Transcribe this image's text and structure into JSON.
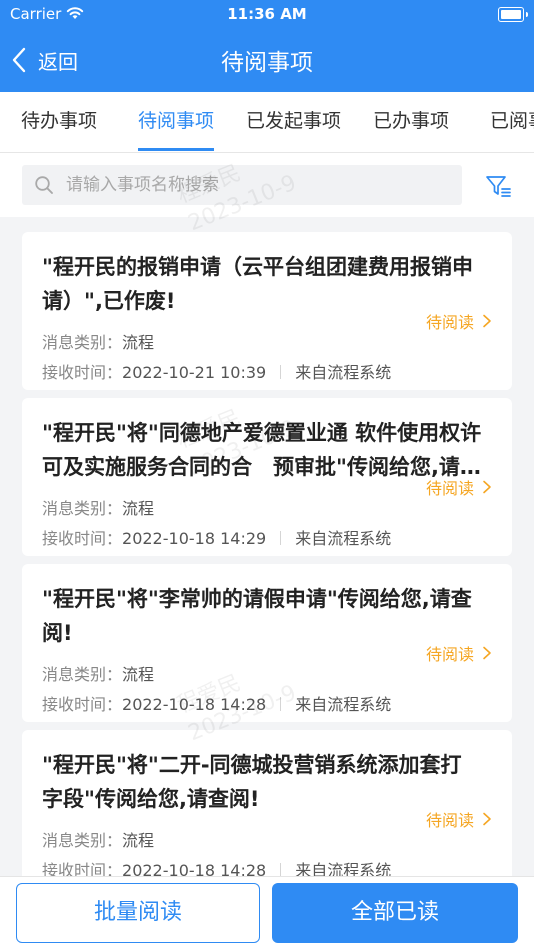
{
  "status_bar": {
    "carrier": "Carrier",
    "time": "11:36 AM"
  },
  "nav": {
    "back_label": "返回",
    "title": "待阅事项"
  },
  "tabs": [
    {
      "label": "待办事项"
    },
    {
      "label": "待阅事项"
    },
    {
      "label": "已发起事项"
    },
    {
      "label": "已办事项"
    },
    {
      "label": "已阅事项"
    }
  ],
  "search": {
    "placeholder": "请输入事项名称搜索"
  },
  "watermark": {
    "name": "程爱民",
    "date": "2023-10-9"
  },
  "labels": {
    "type_label": "消息类别：",
    "time_label": "接收时间："
  },
  "items": [
    {
      "title": "\"程开民的报销申请（云平台组团建费用报销申请）\",已作废!",
      "status": "待阅读",
      "type": "流程",
      "time": "2022-10-21 10:39",
      "source": "来自流程系统"
    },
    {
      "title": "\"程开民\"将\"同德地产爱德置业通 软件使用权许可及实施服务合同的合　预审批\"传阅给您,请查阅!",
      "status": "待阅读",
      "type": "流程",
      "time": "2022-10-18 14:29",
      "source": "来自流程系统"
    },
    {
      "title": "\"程开民\"将\"李常帅的请假申请\"传阅给您,请查阅!",
      "status": "待阅读",
      "type": "流程",
      "time": "2022-10-18 14:28",
      "source": "来自流程系统"
    },
    {
      "title": "\"程开民\"将\"二开-同德城投营销系统添加套打字段\"传阅给您,请查阅!",
      "status": "待阅读",
      "type": "流程",
      "time": "2022-10-18 14:28",
      "source": "来自流程系统"
    }
  ],
  "bottom": {
    "batch_label": "批量阅读",
    "all_read_label": "全部已读"
  },
  "colors": {
    "primary": "#2f8bf3",
    "status": "#f5a623",
    "background": "#f3f4f6"
  }
}
